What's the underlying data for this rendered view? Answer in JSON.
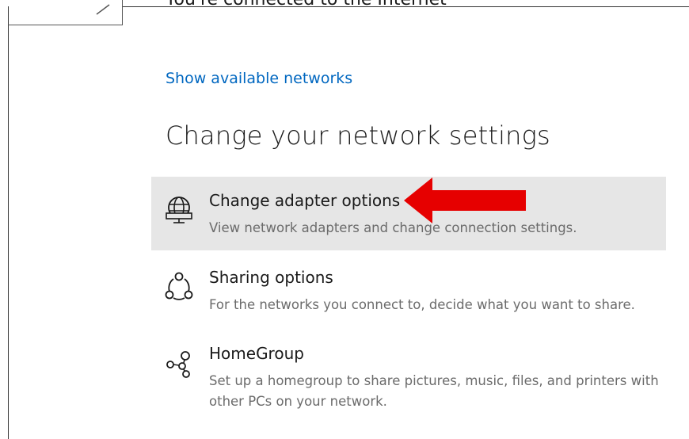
{
  "header": {
    "status_text": "You're connected to the Internet"
  },
  "show_networks_link": "Show available networks",
  "section_heading": "Change your network settings",
  "options": [
    {
      "title": "Change adapter options",
      "description": "View network adapters and change connection settings.",
      "icon": "adapter-globe-icon",
      "highlighted": true
    },
    {
      "title": "Sharing options",
      "description": "For the networks you connect to, decide what you want to share.",
      "icon": "sharing-icon",
      "highlighted": false
    },
    {
      "title": "HomeGroup",
      "description": "Set up a homegroup to share pictures, music, files, and printers with other PCs on your network.",
      "icon": "homegroup-icon",
      "highlighted": false
    }
  ],
  "annotation": {
    "arrow_color": "#e60000",
    "arrow_direction": "left"
  },
  "colors": {
    "link": "#0067c0",
    "highlight": "#e6e6e6",
    "description": "#6b6b6b"
  }
}
